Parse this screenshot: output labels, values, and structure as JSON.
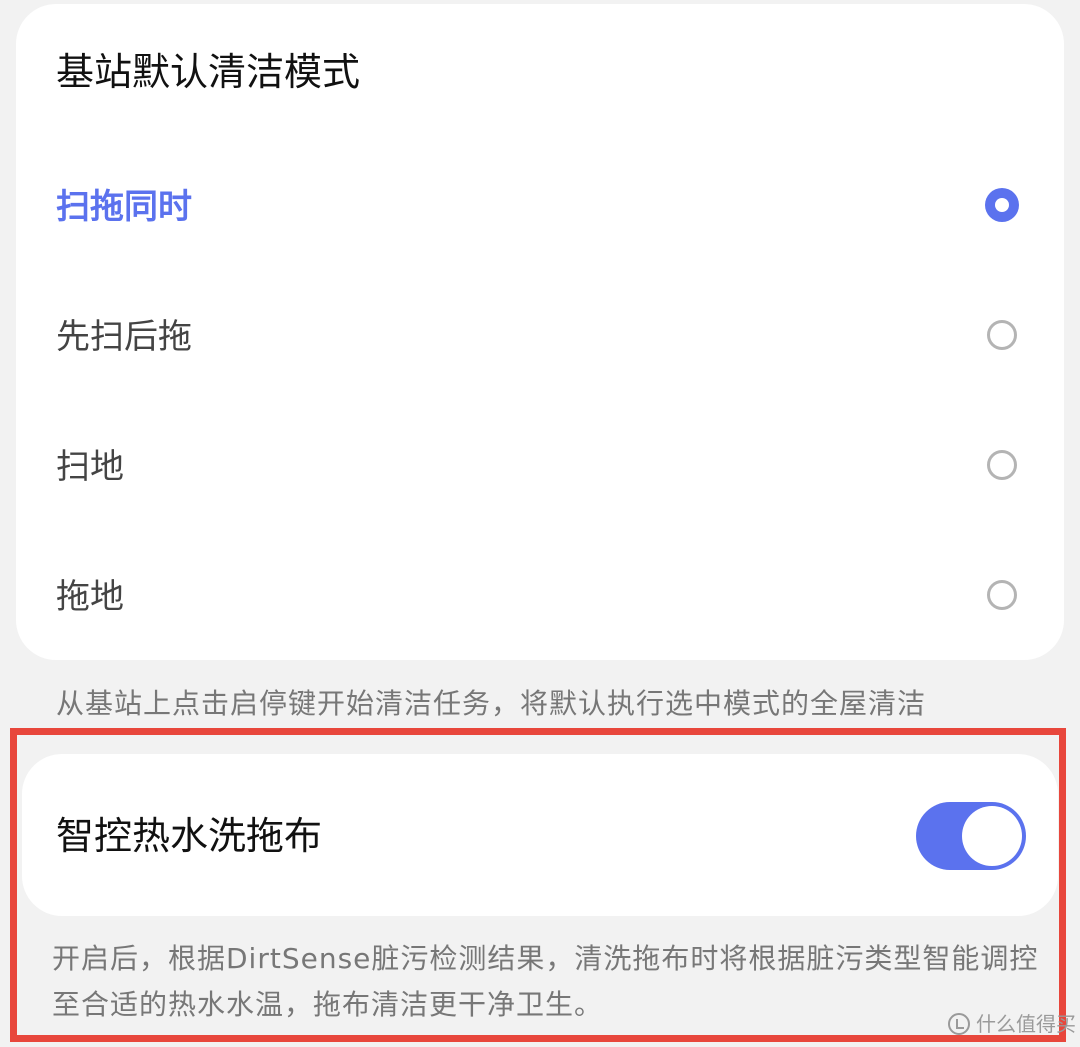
{
  "mode_card": {
    "title": "基站默认清洁模式",
    "options": [
      {
        "label": "扫拖同时",
        "selected": true
      },
      {
        "label": "先扫后拖",
        "selected": false
      },
      {
        "label": "扫地",
        "selected": false
      },
      {
        "label": "拖地",
        "selected": false
      }
    ],
    "hint": "从基站上点击启停键开始清洁任务，将默认执行选中模式的全屋清洁"
  },
  "hot_water_card": {
    "label": "智控热水洗拖布",
    "enabled": true,
    "hint": "开启后，根据DirtSense脏污检测结果，清洗拖布时将根据脏污类型智能调控至合适的热水水温，拖布清洁更干净卫生。"
  },
  "watermark": {
    "text": "什么值得买",
    "icon": "smzdm-logo-icon"
  },
  "colors": {
    "accent": "#5b72ee",
    "highlight_border": "#e8473c",
    "background": "#f2f2f2"
  }
}
